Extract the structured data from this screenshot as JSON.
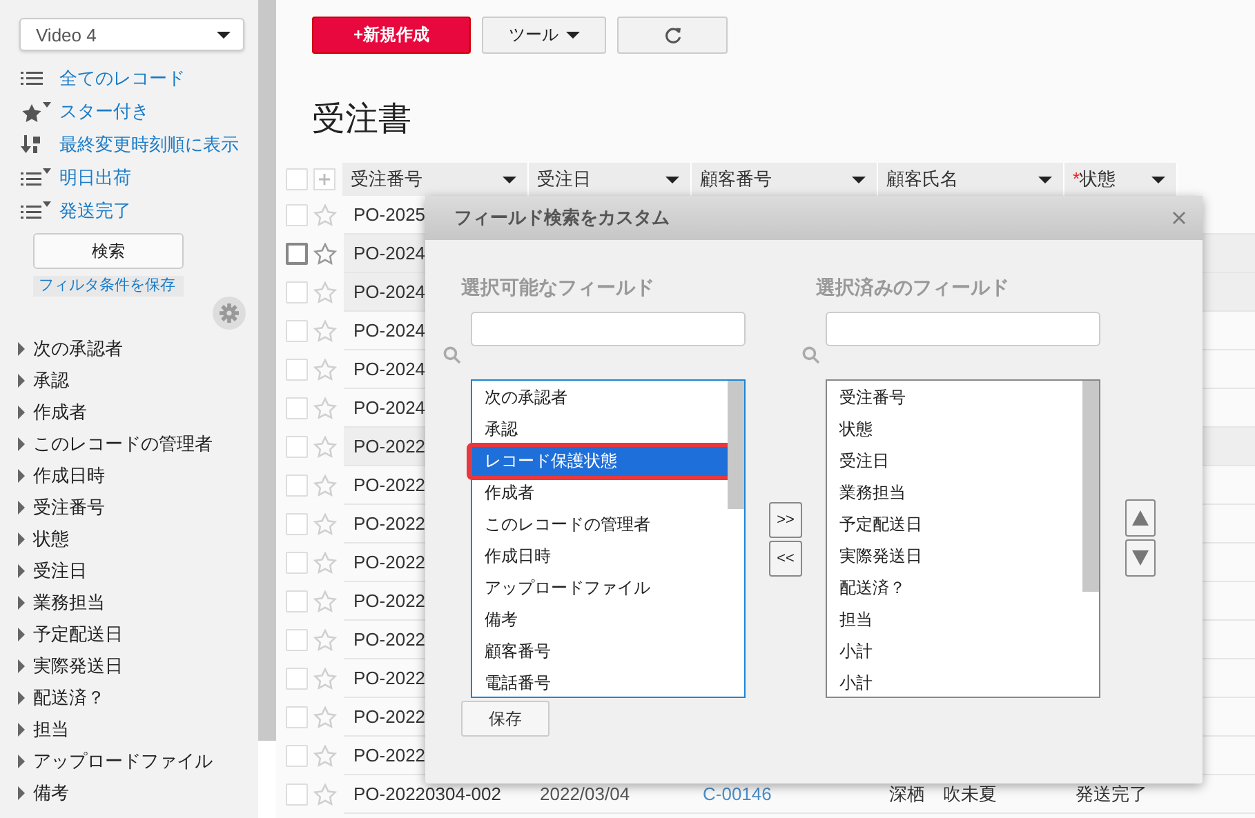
{
  "sidebar": {
    "view_select": "Video 4",
    "filters": [
      {
        "label": "全てのレコード",
        "kind": "list"
      },
      {
        "label": "スター付き",
        "kind": "starred"
      },
      {
        "label": "最終変更時刻順に表示",
        "kind": "sort"
      },
      {
        "label": "明日出荷",
        "kind": "filtered"
      },
      {
        "label": "発送完了",
        "kind": "filtered"
      }
    ],
    "search_button": "検索",
    "save_filter_link": "フィルタ条件を保存",
    "fields": [
      {
        "label": "次の承認者",
        "expanded": false
      },
      {
        "label": "承認",
        "expanded": false
      },
      {
        "label": "作成者",
        "expanded": false
      },
      {
        "label": "このレコードの管理者",
        "expanded": false
      },
      {
        "label": "作成日時",
        "expanded": false
      },
      {
        "label": "受注番号",
        "expanded": false
      },
      {
        "label": "状態",
        "expanded": false
      },
      {
        "label": "受注日",
        "expanded": false
      },
      {
        "label": "業務担当",
        "expanded": false
      },
      {
        "label": "予定配送日",
        "expanded": false
      },
      {
        "label": "実際発送日",
        "expanded": false
      },
      {
        "label": "配送済？",
        "expanded": false
      },
      {
        "label": "担当",
        "expanded": false
      },
      {
        "label": "アップロードファイル",
        "expanded": false
      },
      {
        "label": "備考",
        "expanded": false
      }
    ]
  },
  "toolbar": {
    "new_button": "+新規作成",
    "tools_button": "ツール"
  },
  "page_title": "受注書",
  "table": {
    "columns": [
      {
        "label": "受注番号",
        "kind": "text"
      },
      {
        "label": "受注日",
        "kind": "date"
      },
      {
        "label": "顧客番号",
        "kind": "link"
      },
      {
        "label": "顧客氏名",
        "kind": "text"
      },
      {
        "label": "状態",
        "kind": "text",
        "required_mark": "*"
      }
    ],
    "select_all_checked": false,
    "rows": [
      {
        "cells": [
          "PO-2025"
        ],
        "highlighted": false,
        "hovered": false,
        "checked": false
      },
      {
        "cells": [
          "PO-2024"
        ],
        "highlighted": true,
        "hovered": true,
        "checked": false
      },
      {
        "cells": [
          "PO-2024"
        ],
        "highlighted": true,
        "hovered": false,
        "checked": false
      },
      {
        "cells": [
          "PO-2024"
        ],
        "highlighted": false,
        "hovered": false,
        "checked": false
      },
      {
        "cells": [
          "PO-2024"
        ],
        "highlighted": false,
        "hovered": false,
        "checked": false
      },
      {
        "cells": [
          "PO-2024"
        ],
        "highlighted": false,
        "hovered": false,
        "checked": false
      },
      {
        "cells": [
          "PO-2022"
        ],
        "highlighted": true,
        "hovered": false,
        "checked": false
      },
      {
        "cells": [
          "PO-2022"
        ],
        "highlighted": false,
        "hovered": false,
        "checked": false
      },
      {
        "cells": [
          "PO-2022"
        ],
        "highlighted": false,
        "hovered": false,
        "checked": false
      },
      {
        "cells": [
          "PO-2022"
        ],
        "highlighted": false,
        "hovered": false,
        "checked": false
      },
      {
        "cells": [
          "PO-2022"
        ],
        "highlighted": false,
        "hovered": false,
        "checked": false
      },
      {
        "cells": [
          "PO-2022"
        ],
        "highlighted": false,
        "hovered": false,
        "checked": false
      },
      {
        "cells": [
          "PO-2022"
        ],
        "highlighted": false,
        "hovered": false,
        "checked": false
      },
      {
        "cells": [
          "PO-2022"
        ],
        "highlighted": false,
        "hovered": false,
        "checked": false
      },
      {
        "cells": [
          "PO-2022"
        ],
        "highlighted": false,
        "hovered": false,
        "checked": false
      },
      {
        "cells": [
          "PO-20220304-002",
          "2022/03/04",
          "C-00146",
          "深栖　吹未夏",
          "発送完了"
        ],
        "highlighted": false,
        "hovered": false,
        "checked": false
      }
    ]
  },
  "dialog": {
    "title": "フィールド検索をカスタム",
    "available": {
      "label": "選択可能なフィールド",
      "items": [
        {
          "label": "次の承認者",
          "selected": false,
          "outlined": false
        },
        {
          "label": "承認",
          "selected": false,
          "outlined": false
        },
        {
          "label": "レコード保護状態",
          "selected": true,
          "outlined": true
        },
        {
          "label": "作成者",
          "selected": false,
          "outlined": false
        },
        {
          "label": "このレコードの管理者",
          "selected": false,
          "outlined": false
        },
        {
          "label": "作成日時",
          "selected": false,
          "outlined": false
        },
        {
          "label": "アップロードファイル",
          "selected": false,
          "outlined": false
        },
        {
          "label": "備考",
          "selected": false,
          "outlined": false
        },
        {
          "label": "顧客番号",
          "selected": false,
          "outlined": false
        },
        {
          "label": "電話番号",
          "selected": false,
          "outlined": false
        }
      ]
    },
    "chosen": {
      "label": "選択済みのフィールド",
      "items": [
        {
          "label": "受注番号",
          "selected": false,
          "outlined": false
        },
        {
          "label": "状態",
          "selected": false,
          "outlined": false
        },
        {
          "label": "受注日",
          "selected": false,
          "outlined": false
        },
        {
          "label": "業務担当",
          "selected": false,
          "outlined": false
        },
        {
          "label": "予定配送日",
          "selected": false,
          "outlined": false
        },
        {
          "label": "実際発送日",
          "selected": false,
          "outlined": false
        },
        {
          "label": "配送済？",
          "selected": false,
          "outlined": false
        },
        {
          "label": "担当",
          "selected": false,
          "outlined": false
        },
        {
          "label": "小計",
          "selected": false,
          "outlined": false
        },
        {
          "label": "小計",
          "selected": false,
          "outlined": false
        }
      ]
    },
    "add_button": ">>",
    "remove_button": "<<",
    "save_button": "保存"
  }
}
